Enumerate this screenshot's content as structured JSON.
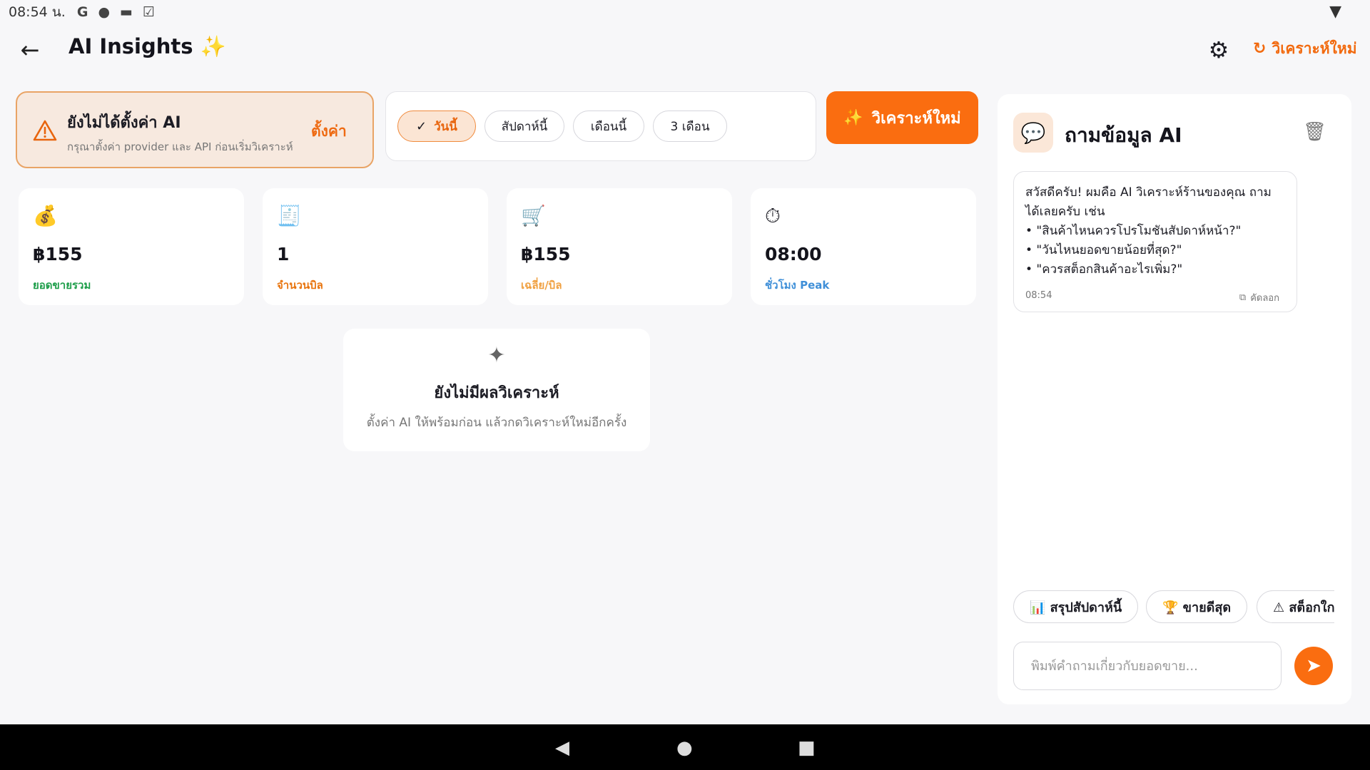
{
  "status_bar": {
    "time": "08:54 น.",
    "icons": [
      "G",
      "person-icon",
      "camera-icon",
      "check-icon"
    ],
    "wifi_icon": "wifi-icon"
  },
  "appbar": {
    "title": "AI Insights ✨",
    "back_icon": "←",
    "gear_icon": "⚙",
    "reanalyze_label": "วิเคราะห์ใหม่",
    "refresh_icon": "↻"
  },
  "warning": {
    "title": "ยังไม่ได้ตั้งค่า AI",
    "subtitle": "กรุณาตั้งค่า provider และ API ก่อนเริ่มวิเคราะห์",
    "action": "ตั้งค่า"
  },
  "periods": {
    "options": [
      "วันนี้",
      "สัปดาห์นี้",
      "เดือนนี้",
      "3 เดือน"
    ],
    "selected": "วันนี้",
    "check_icon": "✓"
  },
  "analyze_button": {
    "label": "วิเคราะห์ใหม่",
    "icon": "✨"
  },
  "stats": [
    {
      "icon": "💰",
      "value": "฿155",
      "label": "ยอดขายรวม",
      "color": "#1e9e4a"
    },
    {
      "icon": "🧾",
      "value": "1",
      "label": "จำนวนบิล",
      "color": "#e8740e"
    },
    {
      "icon": "🛒",
      "value": "฿155",
      "label": "เฉลี่ย/บิล",
      "color": "#f0a040"
    },
    {
      "icon": "⏱",
      "value": "08:00",
      "label": "ชั่วโมง Peak",
      "color": "#3f8fd8"
    }
  ],
  "empty_state": {
    "icon": "✦",
    "title": "ยังไม่มีผลวิเคราะห์",
    "subtitle": "ตั้งค่า AI ให้พร้อมก่อน แล้วกดวิเคราะห์ใหม่อีกครั้ง"
  },
  "chat": {
    "icon": "💬",
    "title": "ถามข้อมูล AI",
    "trash_icon": "🗑",
    "message_lines": [
      "สวัสดีครับ! ผมคือ AI วิเคราะห์ร้านของคุณ ถาม",
      "ได้เลยครับ เช่น",
      "• \"สินค้าไหนควรโปรโมชันสัปดาห์หน้า?\"",
      "• \"วันไหนยอดขายน้อยที่สุด?\"",
      "• \"ควรสต็อกสินค้าอะไรเพิ่ม?\""
    ],
    "message_time": "08:54",
    "copy_label": "คัดลอก",
    "copy_icon": "⧉",
    "quick_actions": [
      "📊 สรุปสัปดาห์นี้",
      "🏆 ขายดีสุด",
      "⚠ สต็อกใกล้หมด"
    ],
    "input_placeholder": "พิมพ์คำถามเกี่ยวกับยอดขาย...",
    "input_value": "",
    "send_icon": "➤"
  },
  "navbar": {
    "back_icon": "◀",
    "home_icon": "●",
    "recents_icon": "■"
  }
}
